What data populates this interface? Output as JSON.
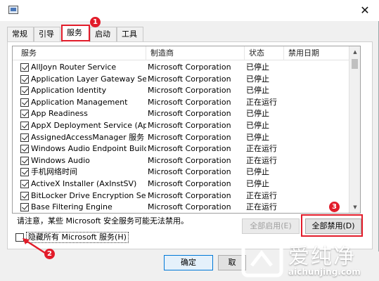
{
  "window": {
    "close_glyph": "✕"
  },
  "tabs": [
    {
      "label": "常规",
      "active": false
    },
    {
      "label": "引导",
      "active": false
    },
    {
      "label": "服务",
      "active": true
    },
    {
      "label": "启动",
      "active": false
    },
    {
      "label": "工具",
      "active": false
    }
  ],
  "list": {
    "columns": [
      "服务",
      "制造商",
      "状态",
      "禁用日期"
    ],
    "rows": [
      {
        "service": "AllJoyn Router Service",
        "vendor": "Microsoft Corporation",
        "status": "已停止",
        "checked": true
      },
      {
        "service": "Application Layer Gateway Service",
        "vendor": "Microsoft Corporation",
        "status": "已停止",
        "checked": true
      },
      {
        "service": "Application Identity",
        "vendor": "Microsoft Corporation",
        "status": "已停止",
        "checked": true
      },
      {
        "service": "Application Management",
        "vendor": "Microsoft Corporation",
        "status": "正在运行",
        "checked": true
      },
      {
        "service": "App Readiness",
        "vendor": "Microsoft Corporation",
        "status": "已停止",
        "checked": true
      },
      {
        "service": "AppX Deployment Service (AppX...",
        "vendor": "Microsoft Corporation",
        "status": "已停止",
        "checked": true
      },
      {
        "service": "AssignedAccessManager 服务",
        "vendor": "Microsoft Corporation",
        "status": "已停止",
        "checked": true
      },
      {
        "service": "Windows Audio Endpoint Builder",
        "vendor": "Microsoft Corporation",
        "status": "正在运行",
        "checked": true
      },
      {
        "service": "Windows Audio",
        "vendor": "Microsoft Corporation",
        "status": "正在运行",
        "checked": true
      },
      {
        "service": "手机网络时间",
        "vendor": "Microsoft Corporation",
        "status": "已停止",
        "checked": true
      },
      {
        "service": "ActiveX Installer (AxInstSV)",
        "vendor": "Microsoft Corporation",
        "status": "已停止",
        "checked": true
      },
      {
        "service": "BitLocker Drive Encryption Service",
        "vendor": "Microsoft Corporation",
        "status": "正在运行",
        "checked": true
      },
      {
        "service": "Base Filtering Engine",
        "vendor": "Microsoft Corporation",
        "status": "正在运行",
        "checked": true
      }
    ]
  },
  "note": "请注意，某些 Microsoft 安全服务可能无法禁用。",
  "buttons": {
    "enable_all": "全部启用(E)",
    "disable_all": "全部禁用(D)",
    "ok": "确定",
    "cancel_partial": "取"
  },
  "hide_ms": {
    "label": "隐藏所有 Microsoft 服务(H)",
    "checked": false
  },
  "annotations": {
    "badge1": "1",
    "badge2": "2",
    "badge3": "3",
    "color": "#e21c2a"
  },
  "watermark": {
    "brand_cn": "爱纯净",
    "url": "aichunjing.com"
  }
}
